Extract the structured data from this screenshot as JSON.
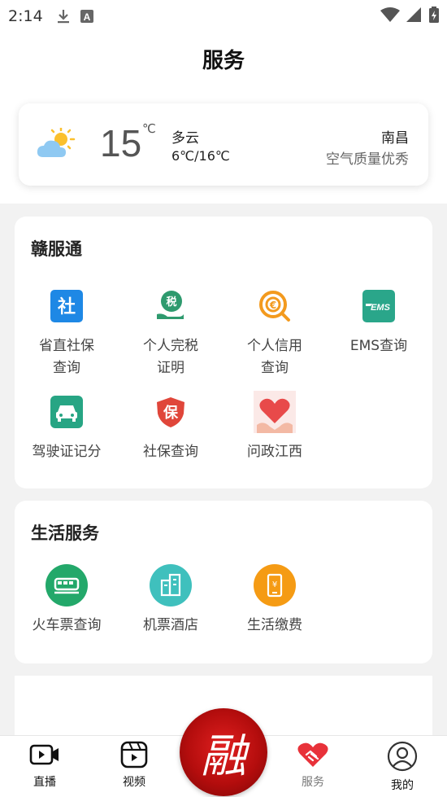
{
  "status_bar": {
    "time": "2:14"
  },
  "header": {
    "title": "服务"
  },
  "weather": {
    "temperature": "15",
    "unit": "℃",
    "condition": "多云",
    "range": "6℃/16℃",
    "city": "南昌",
    "air_quality": "空气质量优秀"
  },
  "ganfutong": {
    "title": "赣服通",
    "items": [
      {
        "label": "省直社保\n查询",
        "icon": "social-security-icon",
        "color": "#1e88e5",
        "glyph": "社"
      },
      {
        "label": "个人完税\n证明",
        "icon": "tax-icon",
        "color": "#2e9a6e",
        "glyph": "税"
      },
      {
        "label": "个人信用\n查询",
        "icon": "credit-icon",
        "color": "#f39a1e",
        "glyph": "C"
      },
      {
        "label": "EMS查询",
        "icon": "ems-icon",
        "color": "#2aa68a",
        "glyph": "EMS"
      },
      {
        "label": "驾驶证记分",
        "icon": "car-icon",
        "color": "#27a584",
        "glyph": ""
      },
      {
        "label": "社保查询",
        "icon": "insurance-shield-icon",
        "color": "#e0463a",
        "glyph": "保"
      },
      {
        "label": "问政江西",
        "icon": "heart-hands-icon",
        "color": "#e84a4a",
        "glyph": ""
      }
    ]
  },
  "life": {
    "title": "生活服务",
    "items": [
      {
        "label": "火车票查询",
        "icon": "train-icon",
        "color": "#23a86a"
      },
      {
        "label": "机票酒店",
        "icon": "hotel-icon",
        "color": "#3fc0bd"
      },
      {
        "label": "生活缴费",
        "icon": "payment-icon",
        "color": "#f59b14"
      }
    ]
  },
  "tabbar": {
    "live": "直播",
    "video": "视频",
    "center": "融",
    "service": "服务",
    "mine": "我的"
  }
}
